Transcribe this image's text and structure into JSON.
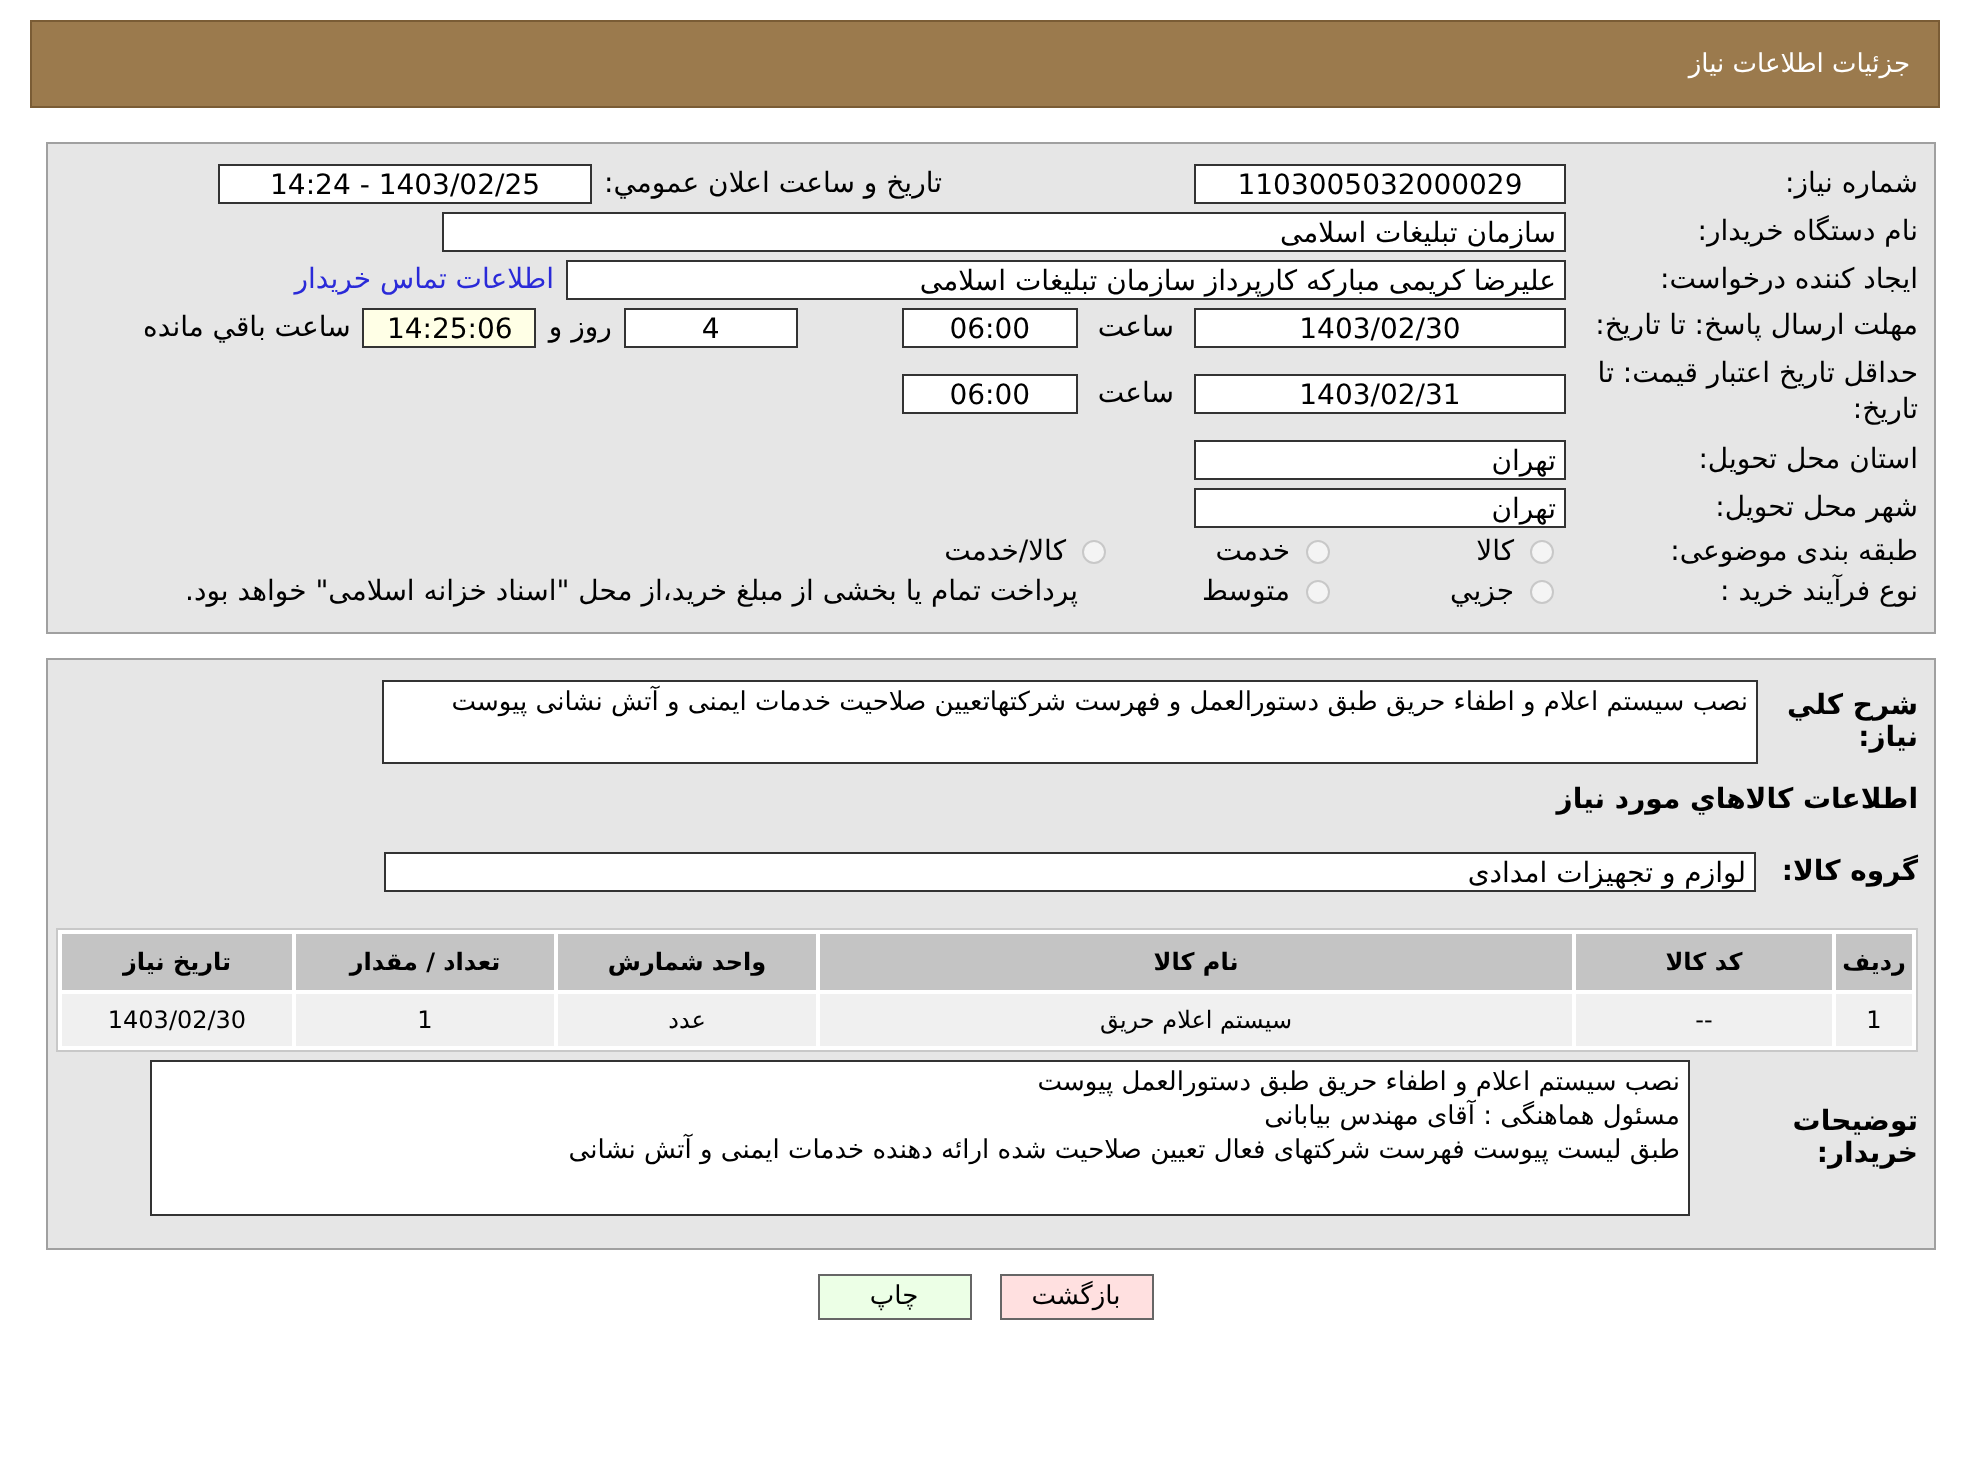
{
  "header": {
    "title": "جزئیات اطلاعات نیاز"
  },
  "need_info": {
    "need_number": {
      "label": "شماره نیاز:",
      "value": "1103005032000029"
    },
    "announce": {
      "label": "تاریخ و ساعت اعلان عمومي:",
      "value": "1403/02/25 - 14:24"
    },
    "buyer_org": {
      "label": "نام دستگاه خریدار:",
      "value": "سازمان تبلیغات اسلامی"
    },
    "requester": {
      "label": "ایجاد کننده درخواست:",
      "value": "علیرضا کریمی مبارکه کارپرداز سازمان تبلیغات اسلامی",
      "link": "اطلاعات تماس خریدار"
    },
    "reply_deadline": {
      "label": "مهلت ارسال پاسخ: تا تاریخ:",
      "date": "1403/02/30",
      "time_label": "ساعت",
      "time": "06:00",
      "days": "4",
      "days_label": "روز و",
      "remaining": "14:25:06",
      "remaining_label": "ساعت باقي مانده"
    },
    "price_validity": {
      "label": "حداقل تاریخ اعتبار قیمت: تا تاریخ:",
      "date": "1403/02/31",
      "time_label": "ساعت",
      "time": "06:00"
    },
    "province": {
      "label": "استان محل تحویل:",
      "value": "تهران"
    },
    "city": {
      "label": "شهر محل تحویل:",
      "value": "تهران"
    },
    "category": {
      "label": "طبقه بندی موضوعی:",
      "options": [
        {
          "label": "کالا",
          "selected": false
        },
        {
          "label": "خدمت",
          "selected": false
        },
        {
          "label": "کالا/خدمت",
          "selected": false
        }
      ]
    },
    "purchase_type": {
      "label": "نوع فرآیند خرید :",
      "options": [
        {
          "label": "جزيي",
          "selected": false
        },
        {
          "label": "متوسط",
          "selected": false
        }
      ],
      "note": "پرداخت تمام يا بخشی از مبلغ خرید،از محل \"اسناد خزانه اسلامی\" خواهد بود."
    }
  },
  "description": {
    "label": "شرح کلي نیاز:",
    "value": "نصب سیستم اعلام و اطفاء حریق طبق دستورالعمل و فهرست شرکتهاتعیین صلاحیت خدمات ایمنی و آتش نشانی پیوست"
  },
  "goods_heading": "اطلاعات کالاهاي مورد نیاز",
  "goods_group": {
    "label": "گروه کالا:",
    "value": "لوازم و تجهیزات امدادی"
  },
  "table": {
    "columns": [
      "ردیف",
      "کد کالا",
      "نام کالا",
      "واحد شمارش",
      "تعداد / مقدار",
      "تاریخ نیاز"
    ],
    "rows": [
      [
        "1",
        "--",
        "سیستم اعلام حریق",
        "عدد",
        "1",
        "1403/02/30"
      ]
    ]
  },
  "buyer_notes": {
    "label": "توضیحات خریدار:",
    "lines": [
      "نصب سیستم اعلام و اطفاء حریق طبق دستورالعمل پیوست",
      "مسئول هماهنگی : آقای مهندس بیابانی",
      "طبق لیست پیوست فهرست شرکتهای فعال تعیین صلاحیت شده ارائه دهنده خدمات ایمنی و آتش نشانی"
    ]
  },
  "buttons": [
    {
      "label": "بازگشت",
      "kind": "back"
    },
    {
      "label": "چاپ",
      "kind": "print"
    }
  ]
}
